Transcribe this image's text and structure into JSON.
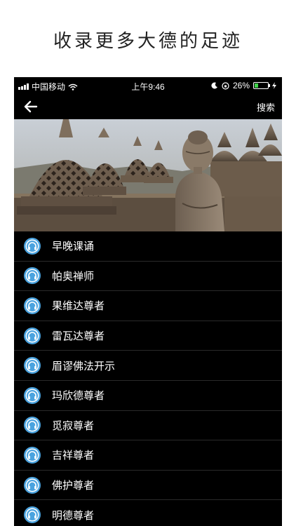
{
  "headline": "收录更多大德的足迹",
  "status_bar": {
    "carrier": "中国移动",
    "time": "上午9:46",
    "battery": "26%",
    "battery_level": 0.26
  },
  "nav": {
    "back_icon": "back-arrow-icon",
    "search_label": "搜索"
  },
  "hero": {
    "subject": "borobudur-buddha-statue-image"
  },
  "list": {
    "icon": "headphones-icon",
    "icon_color": "#4aa3df",
    "items": [
      {
        "label": "早晚课诵"
      },
      {
        "label": "帕奥禅师"
      },
      {
        "label": "果维达尊者"
      },
      {
        "label": "雷瓦达尊者"
      },
      {
        "label": "眉谬佛法开示"
      },
      {
        "label": "玛欣德尊者"
      },
      {
        "label": "觅寂尊者"
      },
      {
        "label": "吉祥尊者"
      },
      {
        "label": "佛护尊者"
      },
      {
        "label": "明德尊者"
      }
    ]
  }
}
